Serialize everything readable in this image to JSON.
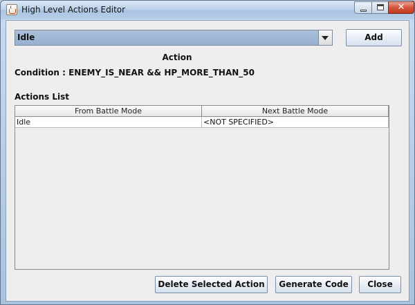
{
  "window": {
    "title": "High Level Actions Editor"
  },
  "toolbar": {
    "action_select_value": "Idle",
    "add_label": "Add"
  },
  "action_header": "Action",
  "condition_text": "Condition : ENEMY_IS_NEAR && HP_MORE_THAN_50",
  "actions_list": {
    "label": "Actions List",
    "columns": [
      "From Battle Mode",
      "Next Battle Mode"
    ],
    "rows": [
      [
        "Idle",
        "<NOT SPECIFIED>"
      ]
    ]
  },
  "footer": {
    "delete_label": "Delete Selected Action",
    "generate_label": "Generate Code",
    "close_label": "Close"
  },
  "icons": {
    "app": "java-cup-icon",
    "minimize": "minimize-icon",
    "maximize": "maximize-icon",
    "close": "close-icon",
    "dropdown": "chevron-down-icon"
  },
  "colors": {
    "combo_selected": "#a9bfda",
    "close_button": "#c23a20",
    "dialog_background": "#eeeeee"
  }
}
